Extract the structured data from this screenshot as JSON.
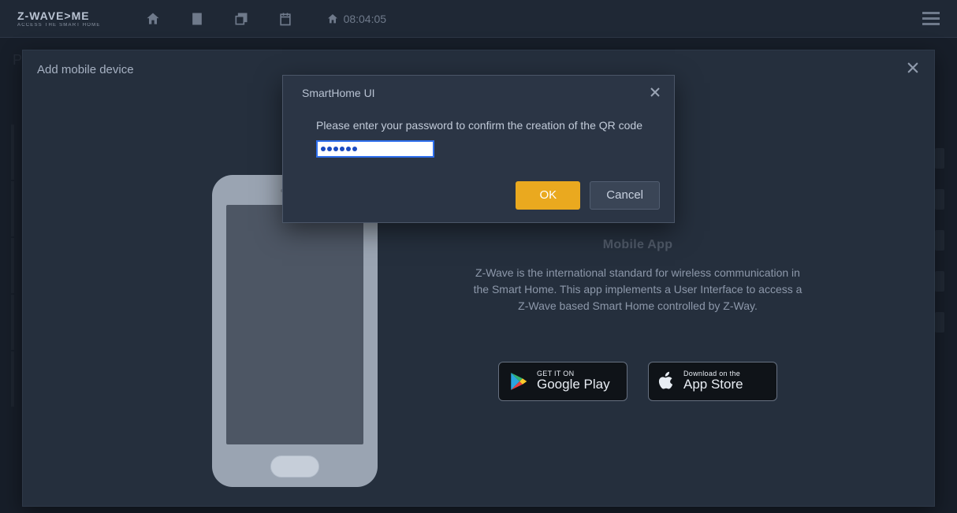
{
  "brand": {
    "name": "Z-WAVE>ME",
    "tagline": "ACCESS THE SMART HOME"
  },
  "clock": "08:04:05",
  "page_under_fragment": "Ple",
  "modal1": {
    "title": "Add mobile device",
    "app_heading": "Mobile App",
    "description": "Z-Wave is the international standard for wireless communication in the Smart Home. This app implements a User Interface to access a Z-Wave based Smart Home controlled by Z-Way.",
    "google_small": "GET IT ON",
    "google_big": "Google Play",
    "apple_small": "Download on the",
    "apple_big": "App Store"
  },
  "dialog": {
    "title": "SmartHome UI",
    "message": "Please enter your password to confirm the creation of the QR code",
    "password_masked": "••••••",
    "ok": "OK",
    "cancel": "Cancel"
  }
}
